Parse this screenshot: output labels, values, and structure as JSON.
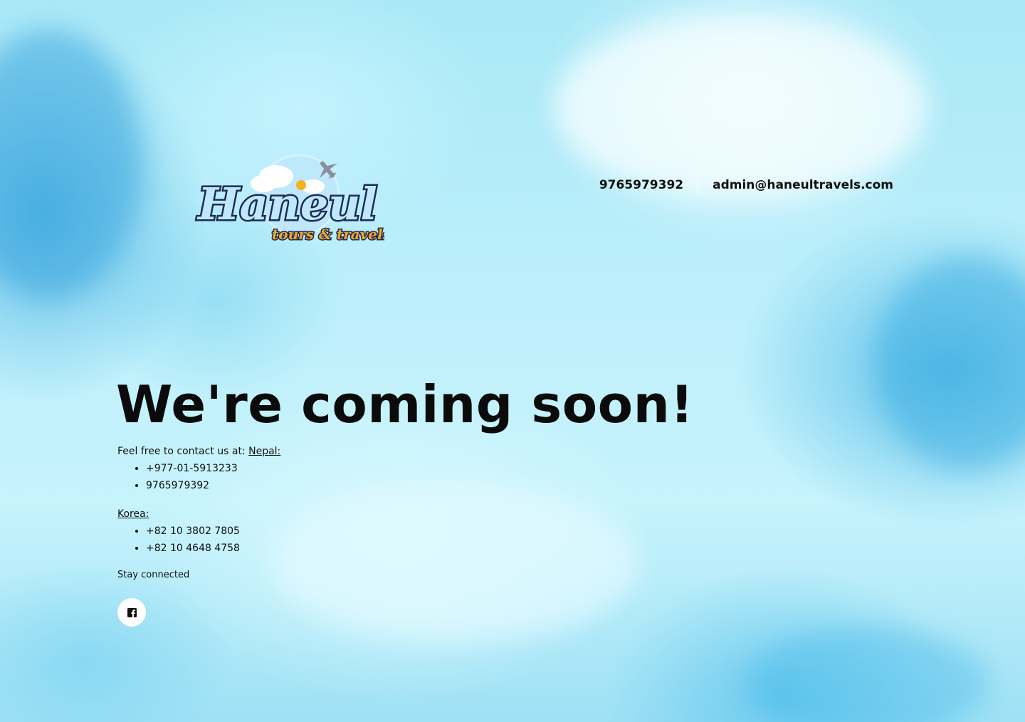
{
  "header": {
    "logo": {
      "brand_name": "Haneul",
      "tagline": "tours & travels"
    },
    "phone": "9765979392",
    "email": "admin@haneultravels.com"
  },
  "main": {
    "headline": "We're coming soon!",
    "contact_intro": "Feel free to contact us at: ",
    "nepal_label": "Nepal:",
    "nepal_numbers": [
      "+977-01-5913233",
      "9765979392"
    ],
    "korea_label": "Korea:",
    "korea_numbers": [
      "+82 10 3802 7805",
      "+82 10 4648 4758"
    ],
    "stay_connected": "Stay connected"
  },
  "social": {
    "facebook_icon": "facebook-icon"
  },
  "colors": {
    "background_sky": "#aeeaf8",
    "text": "#111111",
    "logo_blue": "#1f2b56",
    "logo_orange": "#f5a623"
  }
}
